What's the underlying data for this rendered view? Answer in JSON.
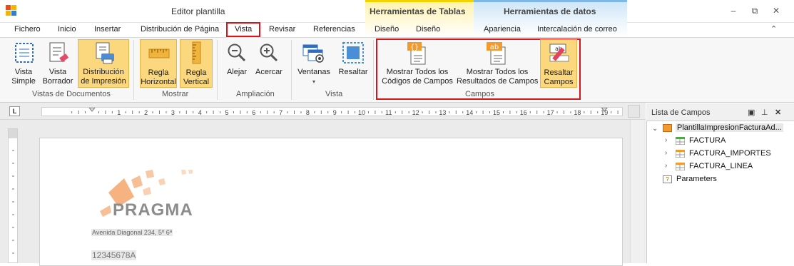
{
  "window": {
    "title": "Editor plantilla",
    "minimize": "–",
    "restore": "⧉",
    "close": "✕"
  },
  "context_tabs": {
    "tables": "Herramientas de Tablas",
    "data": "Herramientas de datos"
  },
  "tabs": [
    "Fichero",
    "Inicio",
    "Insertar",
    "Distribución de Página",
    "Vista",
    "Revisar",
    "Referencias",
    "Diseño",
    "Diseño",
    "Apariencia",
    "Intercalación de correo"
  ],
  "active_tab": "Vista",
  "collapse_glyph": "⌃",
  "ribbon": {
    "vistas": {
      "label": "Vistas de Documentos",
      "simple": [
        "Vista",
        "Simple"
      ],
      "borrador": [
        "Vista",
        "Borrador"
      ],
      "distribucion": [
        "Distribución",
        "de Impresión"
      ]
    },
    "mostrar": {
      "label": "Mostrar",
      "regla_h": [
        "Regla",
        "Horizontal"
      ],
      "regla_v": [
        "Regla",
        "Vertical"
      ]
    },
    "ampliacion": {
      "label": "Ampliación",
      "alejar": "Alejar",
      "acercar": "Acercar"
    },
    "vista": {
      "label": "Vista",
      "ventanas": "Ventanas",
      "resaltar": "Resaltar"
    },
    "campos": {
      "label": "Campos",
      "codigos": [
        "Mostrar Todos los",
        "Códigos de Campos"
      ],
      "resultados": [
        "Mostrar Todos los",
        "Resultados de Campos"
      ],
      "resaltar": [
        "Resaltar",
        "Campos"
      ]
    }
  },
  "ruler": {
    "corner": "L",
    "numbers": [
      "1",
      "2",
      "3",
      "4",
      "5",
      "6",
      "7",
      "8",
      "9",
      "10",
      "11",
      "12",
      "13",
      "14",
      "15",
      "16",
      "17",
      "18",
      "19"
    ]
  },
  "document": {
    "logo": "PRAGMA",
    "address": "Avenida Diagonal 234, 5º 6ª",
    "nif": "12345678A"
  },
  "field_panel": {
    "title": "Lista de Campos",
    "root": "PlantillaImpresionFacturaAd...",
    "items": [
      "FACTURA",
      "FACTURA_IMPORTES",
      "FACTURA_LINEA"
    ],
    "parameters": "Parameters"
  },
  "colors": {
    "accent_red": "#d9141b",
    "selected": "#fbd77d",
    "ctx_tables": "#f5d100",
    "ctx_data": "#7fb8e6",
    "logo_orange": "#f4a46a"
  }
}
